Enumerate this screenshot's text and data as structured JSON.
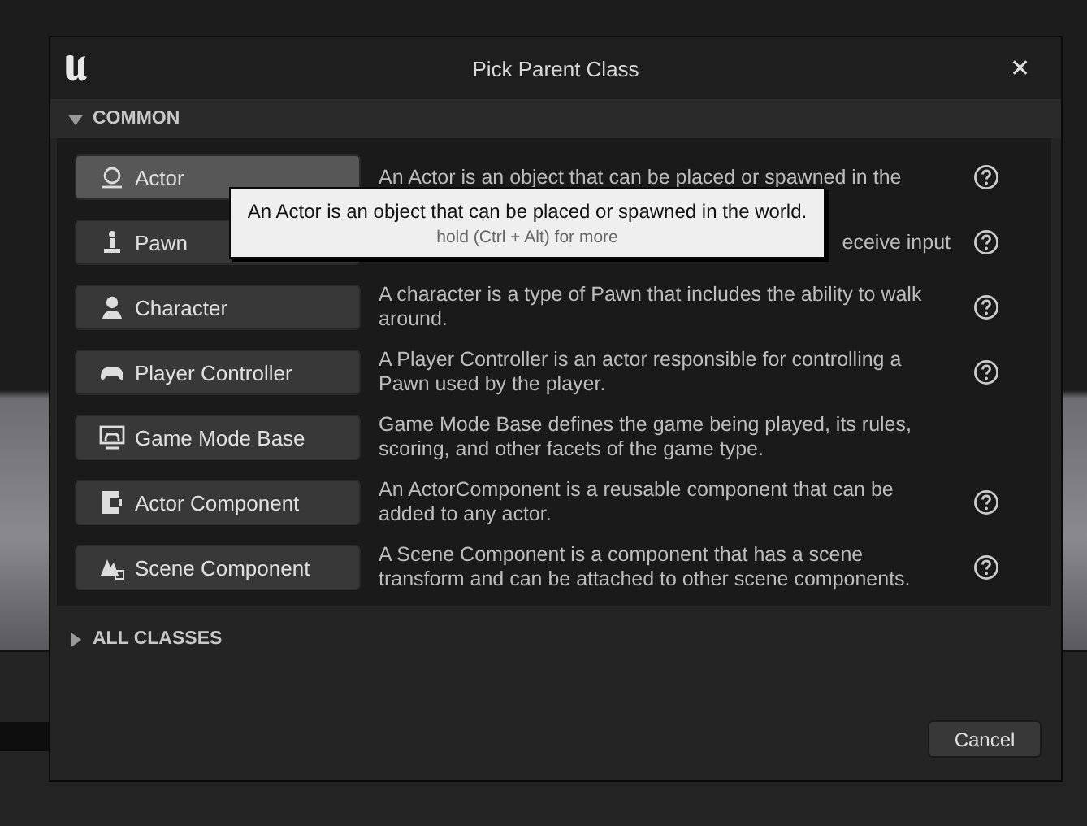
{
  "window": {
    "title": "Pick Parent Class",
    "close": "✕"
  },
  "sections": [
    {
      "label": "COMMON",
      "expanded": true,
      "rows": [
        {
          "kind": "actor",
          "label": "Actor",
          "hovered": true,
          "desc": "An Actor is an object that can be placed or spawned in the",
          "obscured": false,
          "help": true
        },
        {
          "kind": "pawn",
          "label": "Pawn",
          "hovered": false,
          "desc": "eceive input",
          "obscured": true,
          "help": true
        },
        {
          "kind": "character",
          "label": "Character",
          "hovered": false,
          "desc": "A character is a type of Pawn that includes the ability to walk around.",
          "obscured": false,
          "help": true
        },
        {
          "kind": "controller",
          "label": "Player Controller",
          "hovered": false,
          "desc": "A Player Controller is an actor responsible for controlling a Pawn used by the player.",
          "obscured": false,
          "help": true
        },
        {
          "kind": "gamemode",
          "label": "Game Mode Base",
          "hovered": false,
          "desc": "Game Mode Base defines the game being played, its rules, scoring, and other facets of the game type.",
          "obscured": false,
          "help": false
        },
        {
          "kind": "component",
          "label": "Actor Component",
          "hovered": false,
          "desc": "An ActorComponent is a reusable component that can be added to any actor.",
          "obscured": false,
          "help": true
        },
        {
          "kind": "scene",
          "label": "Scene Component",
          "hovered": false,
          "desc": "A Scene Component is a component that has a scene transform and can be attached to other scene components.",
          "obscured": false,
          "help": true
        }
      ]
    },
    {
      "label": "ALL CLASSES",
      "expanded": false
    }
  ],
  "tooltip": {
    "text": "An Actor is an object that can be placed or spawned in the world.",
    "hint": "hold (Ctrl + Alt) for more"
  },
  "buttons": [
    "Cancel"
  ]
}
